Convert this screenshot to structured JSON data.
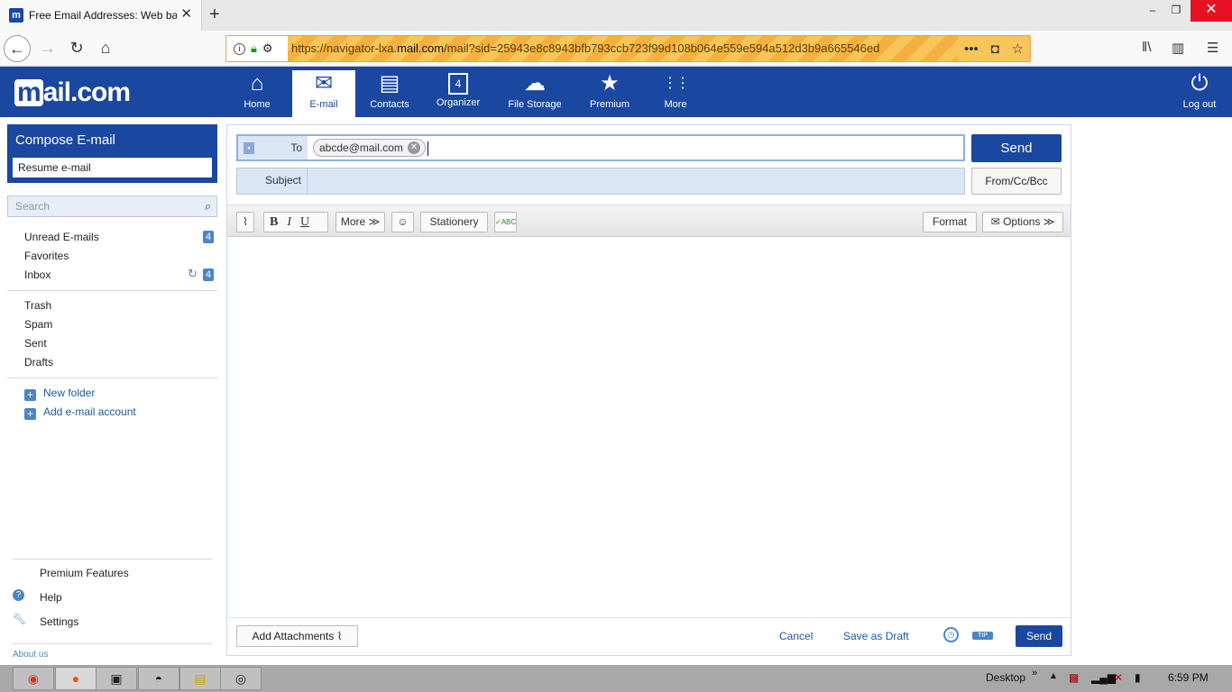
{
  "browser": {
    "tab_title": "Free Email Addresses: Web based",
    "url_prefix": "https://navigator-lxa.",
    "url_domain": "mail.com",
    "url_suffix": "/mail?sid=25943e8c8943bfb793ccb723f99d108b064e559e594a512d3b9a665546ed",
    "favicon": "m"
  },
  "brand": {
    "logo_m": "m",
    "logo_rest": "ail.com"
  },
  "mainnav": [
    {
      "label": "Home",
      "icon": "⌂"
    },
    {
      "label": "E-mail",
      "icon": "✉"
    },
    {
      "label": "Contacts",
      "icon": "▤"
    },
    {
      "label": "Organizer",
      "icon": "4"
    },
    {
      "label": "File Storage",
      "icon": "☁"
    },
    {
      "label": "Premium",
      "icon": "★"
    },
    {
      "label": "More",
      "icon": "⋮⋮"
    }
  ],
  "logout_label": "Log out",
  "sidebar": {
    "compose_label": "Compose E-mail",
    "resume_label": "Resume e-mail",
    "search_placeholder": "Search",
    "folders": [
      {
        "label": "Unread E-mails",
        "count": "4"
      },
      {
        "label": "Favorites"
      },
      {
        "label": "Inbox",
        "count": "4"
      }
    ],
    "folders2": [
      {
        "label": "Trash"
      },
      {
        "label": "Spam"
      },
      {
        "label": "Sent"
      },
      {
        "label": "Drafts"
      }
    ],
    "new_folder": "New folder",
    "add_account": "Add e-mail account",
    "premium_features": "Premium Features",
    "help": "Help",
    "settings": "Settings",
    "about": "About us"
  },
  "compose": {
    "to_label": "To",
    "recipient": "abcde@mail.com",
    "subject_label": "Subject",
    "send_label": "Send",
    "fromccbcc_label": "From/Cc/Bcc",
    "toolbar": {
      "bold": "B",
      "italic": "I",
      "underline": "U",
      "more": "More",
      "stationery": "Stationery",
      "format": "Format",
      "options": "Options"
    },
    "add_attachments": "Add Attachments",
    "cancel": "Cancel",
    "save_draft": "Save as Draft",
    "tip": "TIP",
    "send_bottom": "Send"
  },
  "taskbar": {
    "desktop": "Desktop",
    "time": "6:59 PM"
  },
  "colors": {
    "brand_blue": "#1a47a0",
    "link_blue": "#1a5aa0",
    "badge_blue": "#4a86c8"
  }
}
